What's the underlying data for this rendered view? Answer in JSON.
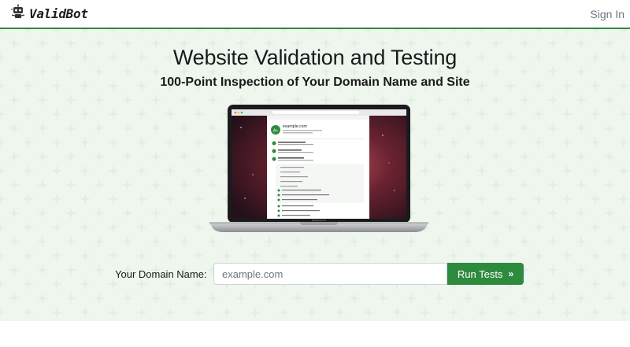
{
  "header": {
    "brand_name": "ValidBot",
    "sign_in_label": "Sign In"
  },
  "hero": {
    "title": "Website Validation and Testing",
    "subtitle": "100-Point Inspection of Your Domain Name and Site",
    "laptop_screen": {
      "site_name": "example.com",
      "grade": "A+",
      "device_label": "MacBook Pro"
    }
  },
  "form": {
    "domain_label": "Your Domain Name:",
    "domain_placeholder": "example.com",
    "run_button_label": "Run Tests",
    "run_button_icon": "double-chevron-right-icon"
  },
  "colors": {
    "accent": "#2e8b3e",
    "hero_background": "#eef6ee",
    "muted_text": "#6c757d"
  }
}
